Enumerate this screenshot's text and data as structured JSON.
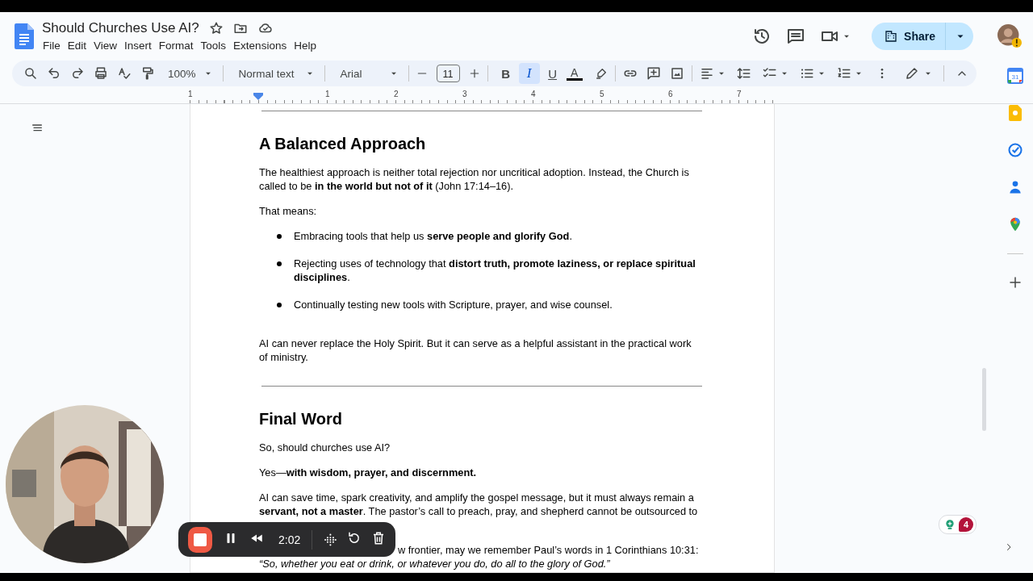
{
  "document": {
    "title": "Should Churches Use AI?"
  },
  "menu": [
    "File",
    "Edit",
    "View",
    "Insert",
    "Format",
    "Tools",
    "Extensions",
    "Help"
  ],
  "share": {
    "label": "Share"
  },
  "toolbar": {
    "zoom": "100%",
    "style": "Normal text",
    "font": "Arial",
    "font_size": "11",
    "text_color": "A",
    "format_buttons": [
      {
        "label": "B",
        "selected": false
      },
      {
        "label": "I",
        "selected": true
      },
      {
        "label": "U",
        "selected": false
      }
    ]
  },
  "ruler": [
    "1",
    "1",
    "2",
    "3",
    "4",
    "5",
    "6",
    "7"
  ],
  "content": [
    {
      "kind": "rule"
    },
    {
      "kind": "heading",
      "text": "A Balanced Approach"
    },
    {
      "kind": "para",
      "text": "The healthiest approach is neither total rejection nor uncritical adoption. Instead, the Church is called to be **in the world but not of it** (John 17:14–16)."
    },
    {
      "kind": "para",
      "text": "That means:"
    },
    {
      "kind": "bullet",
      "text": "Embracing tools that help us **serve people and glorify God**."
    },
    {
      "kind": "bullet",
      "text": "Rejecting uses of technology that **distort truth, promote laziness, or replace spiritual disciplines**."
    },
    {
      "kind": "bullet",
      "text": "Continually testing new tools with Scripture, prayer, and wise counsel."
    },
    {
      "kind": "para",
      "text": "AI can never replace the Holy Spirit. But it can serve as a helpful assistant in the practical work of ministry."
    },
    {
      "kind": "rule"
    },
    {
      "kind": "heading",
      "text": "Final Word"
    },
    {
      "kind": "para",
      "text": "So, should churches use AI?"
    },
    {
      "kind": "para",
      "text": "Yes—**with wisdom, prayer, and discernment.**"
    },
    {
      "kind": "para",
      "text": "AI can save time, spark creativity, and amplify the gospel message, but it must always remain a **servant, not a master**. The pastor’s call to preach, pray, and shepherd cannot be outsourced to"
    },
    {
      "kind": "covered",
      "text": "w frontier, may we remember Paul’s words in 1 Corinthians 10:31:"
    },
    {
      "kind": "quote",
      "text": "“So, whether you eat or drink, or whatever you do, do all to the glory of God.”"
    }
  ],
  "side_panel": {
    "calendar_day": "31"
  },
  "comment_badge": {
    "count": "4"
  },
  "recorder": {
    "time": "2:02"
  }
}
